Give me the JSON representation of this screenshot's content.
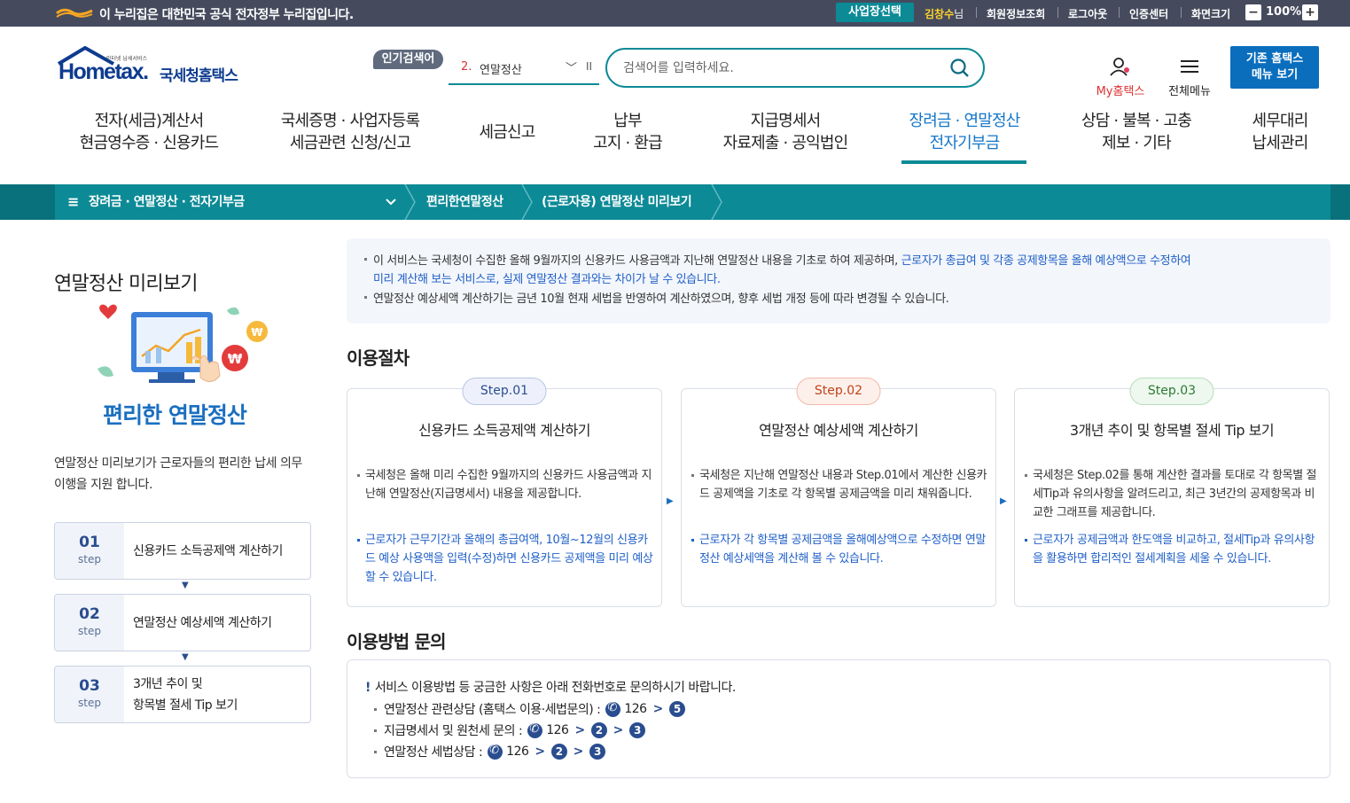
{
  "gov_bar": {
    "text": "이 누리집은 대한민국 공식 전자정부 누리집입니다.",
    "business_select": "사업장선택",
    "user_name": "김창수",
    "user_suffix": "님",
    "links": [
      "회원정보조회",
      "로그아웃",
      "인증센터",
      "화면크기"
    ],
    "zoom_minus": "−",
    "zoom_value": "100%",
    "zoom_plus": "+"
  },
  "header": {
    "logo_small": "인터넷 납세서비스",
    "logo_home": "Hometax.",
    "logo_kr": "국세청홈택스",
    "popular_badge": "인기검색어",
    "popular_rank": "2.",
    "popular_word": "연말정산",
    "search_placeholder": "검색어를 입력하세요.",
    "my_hometax": "My홈택스",
    "all_menu": "전체메뉴",
    "old_menu": "기존 홈택스\n메뉴 보기"
  },
  "gnb": [
    "전자(세금)계산서\n현금영수증 · 신용카드",
    "국세증명 · 사업자등록\n세금관련 신청/신고",
    "세금신고",
    "납부\n고지 · 환급",
    "지급명세서\n자료제출 · 공익법인",
    "장려금 · 연말정산\n전자기부금",
    "상담 · 불복 · 고충\n제보 · 기타",
    "세무대리\n납세관리"
  ],
  "location": {
    "menu_icon": "≡",
    "level1": "장려금 · 연말정산 · 전자기부금",
    "level2": "편리한연말정산",
    "level3": "(근로자용) 연말정산 미리보기"
  },
  "left_panel": {
    "title": "연말정산 미리보기",
    "subtitle": "편리한 연말정산",
    "description": "연말정산 미리보기가 근로자들의  편리한 납세 의무 이행을 지원 합니다.",
    "steps": [
      {
        "num": "01",
        "step": "step",
        "text": "신용카드 소득공제액 계산하기"
      },
      {
        "num": "02",
        "step": "step",
        "text": "연말정산 예상세액 계산하기"
      },
      {
        "num": "03",
        "step": "step",
        "text": "3개년 추이 및\n항목별 절세 Tip 보기"
      }
    ]
  },
  "notice": {
    "line1_a": "이 서비스는 국세청이 수집한 올해 9월까지의 신용카드 사용금액과 지난해 연말정산 내용을 기초로 하여 제공하며, ",
    "line1_b": "근로자가 총급여 및 각종 공제항목을 올해 예상액으로 수정하여",
    "line2": "미리 계산해 보는 서비스로, 실제 연말정산 결과와는 차이가 날 수 있습니다.",
    "line3": "연말정산 예상세액 계산하기는 금년 10월 현재 세법을 반영하여 계산하였으며, 향후 세법 개정 등에 따라 변경될 수 있습니다."
  },
  "procedure": {
    "title": "이용절차",
    "cards": [
      {
        "badge": "Step.01",
        "title": "신용카드 소득공제액 계산하기",
        "desc": "국세청은 올해 미리 수집한 9월까지의 신용카드 사용금액과 지난해 연말정산(지급명세서) 내용을 제공합니다.",
        "note": "근로자가 근무기간과 올해의 총급여액, 10월~12월의 신용카드 예상 사용액을 입력(수정)하면 신용카드 공제액을 미리 예상할 수 있습니다."
      },
      {
        "badge": "Step.02",
        "title": "연말정산 예상세액 계산하기",
        "desc": "국세청은 지난해 연말정산 내용과 Step.01에서 계산한 신용카드 공제액을 기초로 각 항목별 공제금액을 미리 채워줍니다.",
        "note": "근로자가 각 항목별 공제금액을 올해예상액으로 수정하면 연말정산 예상세액을 계산해 볼 수 있습니다."
      },
      {
        "badge": "Step.03",
        "title": "3개년 추이 및 항목별 절세 Tip 보기",
        "desc": "국세청은 Step.02를 통해 계산한 결과를 토대로 각 항목별 절세Tip과 유의사항을 알려드리고, 최근 3년간의 공제항목과 비교한 그래프를 제공합니다.",
        "note": "근로자가 공제금액과 한도액을 비교하고, 절세Tip과 유의사항을 활용하면 합리적인 절세계획을 세울 수 있습니다."
      }
    ],
    "badge_colors": [
      {
        "border": "#b8c4e6",
        "bg": "#eef1fb",
        "text": "#2a4d8f"
      },
      {
        "border": "#f3b9a8",
        "bg": "#fdf0ea",
        "text": "#c2421b"
      },
      {
        "border": "#b7ddb9",
        "bg": "#eef8ee",
        "text": "#2d7a35"
      }
    ]
  },
  "inquiry": {
    "title": "이용방법 문의",
    "notice": "서비스 이용방법 등 궁금한 사항은 아래 전화번호로 문의하시기 바랍니다.",
    "rows": [
      {
        "label": "연말정산 관련상담 (홈택스 이용·세법문의) :",
        "number": "126",
        "keys": [
          "5"
        ]
      },
      {
        "label": "지급명세서 및 원천세 문의 :",
        "number": "126",
        "keys": [
          "2",
          "3"
        ]
      },
      {
        "label": "연말정산 세법상담 :",
        "number": "126",
        "keys": [
          "2",
          "3"
        ]
      }
    ]
  },
  "colors": {
    "teal": "#0c8a96",
    "navy_bar": "#454b5d",
    "blue_link": "#1f5fc7",
    "active_menu": "#1476c9"
  },
  "icons": [
    "e-gov-logo",
    "search-icon",
    "user-icon",
    "hamburger-icon",
    "phone-icon",
    "chevron-down-icon",
    "pause-icon"
  ]
}
